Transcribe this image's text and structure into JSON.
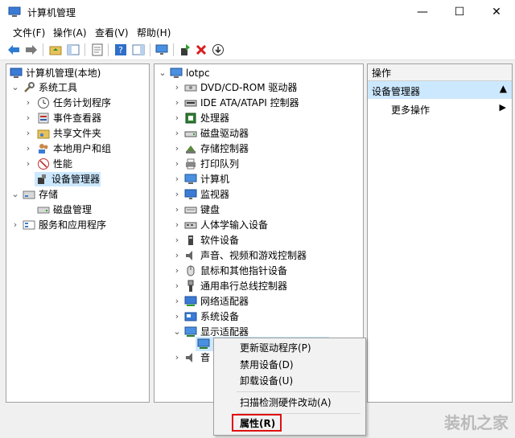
{
  "window": {
    "title": "计算机管理"
  },
  "controls": {
    "minimize": "—",
    "maximize": "☐",
    "close": "✕"
  },
  "menu": [
    "文件(F)",
    "操作(A)",
    "查看(V)",
    "帮助(H)"
  ],
  "left_tree": [
    {
      "label": "计算机管理(本地)",
      "level": 0,
      "twisty": ""
    },
    {
      "label": "系统工具",
      "level": 1,
      "twisty": "expanded"
    },
    {
      "label": "任务计划程序",
      "level": 2,
      "twisty": "collapsed"
    },
    {
      "label": "事件查看器",
      "level": 2,
      "twisty": "collapsed"
    },
    {
      "label": "共享文件夹",
      "level": 2,
      "twisty": "collapsed"
    },
    {
      "label": "本地用户和组",
      "level": 2,
      "twisty": "collapsed"
    },
    {
      "label": "性能",
      "level": 2,
      "twisty": "collapsed"
    },
    {
      "label": "设备管理器",
      "level": 2,
      "twisty": "",
      "selected": true
    },
    {
      "label": "存储",
      "level": 1,
      "twisty": "expanded"
    },
    {
      "label": "磁盘管理",
      "level": 2,
      "twisty": ""
    },
    {
      "label": "服务和应用程序",
      "level": 1,
      "twisty": "collapsed"
    }
  ],
  "device_tree": {
    "root": "lotpc",
    "items": [
      "DVD/CD-ROM 驱动器",
      "IDE ATA/ATAPI 控制器",
      "处理器",
      "磁盘驱动器",
      "存储控制器",
      "打印队列",
      "计算机",
      "监视器",
      "键盘",
      "人体学输入设备",
      "软件设备",
      "声音、视频和游戏控制器",
      "鼠标和其他指针设备",
      "通用串行总线控制器",
      "网络适配器",
      "系统设备",
      "显示适配器"
    ],
    "partial_item": "音"
  },
  "actions": {
    "header": "操作",
    "section": "设备管理器",
    "more": "更多操作"
  },
  "context_menu": {
    "items": [
      "更新驱动程序(P)",
      "禁用设备(D)",
      "卸载设备(U)",
      "扫描检测硬件改动(A)",
      "属性(R)"
    ]
  },
  "watermark": "装机之家",
  "colors": {
    "selection": "#cce8ff",
    "action_header": "#cce8ff",
    "highlight_border": "#e01010"
  }
}
